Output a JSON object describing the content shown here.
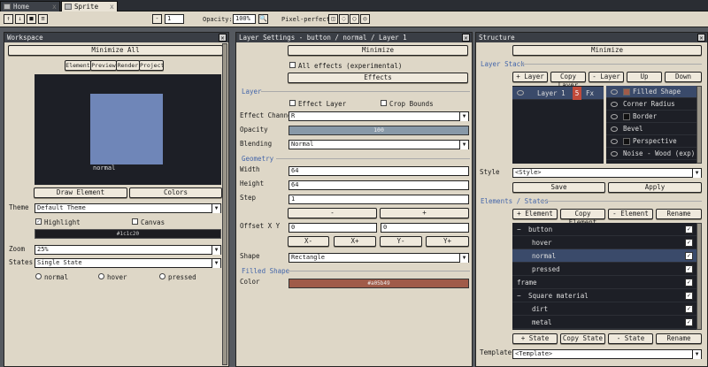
{
  "tabs": {
    "home": "Home",
    "sprite": "Sprite",
    "close": "x"
  },
  "toolbar": {
    "page_value": "1",
    "opacity_label": "Opacity:",
    "opacity_value": "100%",
    "pixel_perfect_label": "Pixel-perfect"
  },
  "workspace": {
    "title": "Workspace",
    "minimize_all": "Minimize All",
    "tabs": [
      "Element",
      "Preview",
      "Render",
      "Project"
    ],
    "preview_caption": "normal",
    "preview_bg": "#1d1f26",
    "preview_color": "#6f86b8",
    "draw_element": "Draw Element",
    "colors": "Colors",
    "theme_label": "Theme",
    "theme_value": "Default Theme",
    "highlight": "Highlight",
    "canvas": "Canvas",
    "canvas_color_hex": "#1c1c20",
    "zoom_label": "Zoom",
    "zoom_value": "25%",
    "states_label": "States",
    "states_value": "Single State",
    "states_radios": [
      "normal",
      "hover",
      "pressed"
    ]
  },
  "layer_settings": {
    "title": "Layer Settings - button / normal / Layer 1",
    "minimize": "Minimize",
    "all_effects": "All effects (experimental)",
    "effects": "Effects",
    "layer_section": "Layer",
    "effect_layer": "Effect Layer",
    "crop_bounds": "Crop Bounds",
    "effect_channel_label": "Effect Channel",
    "effect_channel_value": "R",
    "opacity_label": "Opacity",
    "opacity_value": "100",
    "blending_label": "Blending",
    "blending_value": "Normal",
    "geometry_section": "Geometry",
    "width_label": "Width",
    "width_value": "64",
    "height_label": "Height",
    "height_value": "64",
    "step_label": "Step",
    "step_value": "1",
    "minus": "-",
    "plus": "+",
    "offset_label": "Offset X Y",
    "offset_x": "0",
    "offset_y": "0",
    "x_minus": "X-",
    "x_plus": "X+",
    "y_minus": "Y-",
    "y_plus": "Y+",
    "shape_label": "Shape",
    "shape_value": "Rectangle",
    "filled_shape_section": "Filled Shape",
    "color_label": "Color",
    "color_hex": "#a05b49"
  },
  "structure": {
    "title": "Structure",
    "minimize": "Minimize",
    "layer_stack": "Layer Stack",
    "layer_buttons": [
      "+ Layer",
      "Copy Layer",
      "- Layer",
      "Up",
      "Down"
    ],
    "layer_name": "Layer 1",
    "layer_badge": "5",
    "layer_fx": "Fx",
    "effects": [
      {
        "name": "Filled Shape",
        "swatch": "#a05b49"
      },
      {
        "name": "Corner Radius",
        "swatch": ""
      },
      {
        "name": "Border",
        "swatch": "#111111"
      },
      {
        "name": "Bevel",
        "swatch": ""
      },
      {
        "name": "Perspective",
        "swatch": "#111111"
      },
      {
        "name": "Noise - Wood (exp)",
        "swatch": ""
      }
    ],
    "style_label": "Style",
    "style_value": "<Style>",
    "save": "Save",
    "apply": "Apply",
    "elements_section": "Elements / States",
    "element_buttons": [
      "+ Element",
      "Copy Element",
      "- Element",
      "Rename"
    ],
    "tree": [
      {
        "label": "button",
        "indent": 0,
        "exp": "−"
      },
      {
        "label": "hover",
        "indent": 1,
        "exp": ""
      },
      {
        "label": "normal",
        "indent": 1,
        "exp": ""
      },
      {
        "label": "pressed",
        "indent": 1,
        "exp": ""
      },
      {
        "label": "frame",
        "indent": 0,
        "exp": ""
      },
      {
        "label": "Square material",
        "indent": 0,
        "exp": "−"
      },
      {
        "label": "dirt",
        "indent": 1,
        "exp": ""
      },
      {
        "label": "metal",
        "indent": 1,
        "exp": ""
      }
    ],
    "state_buttons": [
      "+ State",
      "Copy State",
      "- State",
      "Rename"
    ],
    "template_label": "Template",
    "template_value": "<Template>"
  }
}
